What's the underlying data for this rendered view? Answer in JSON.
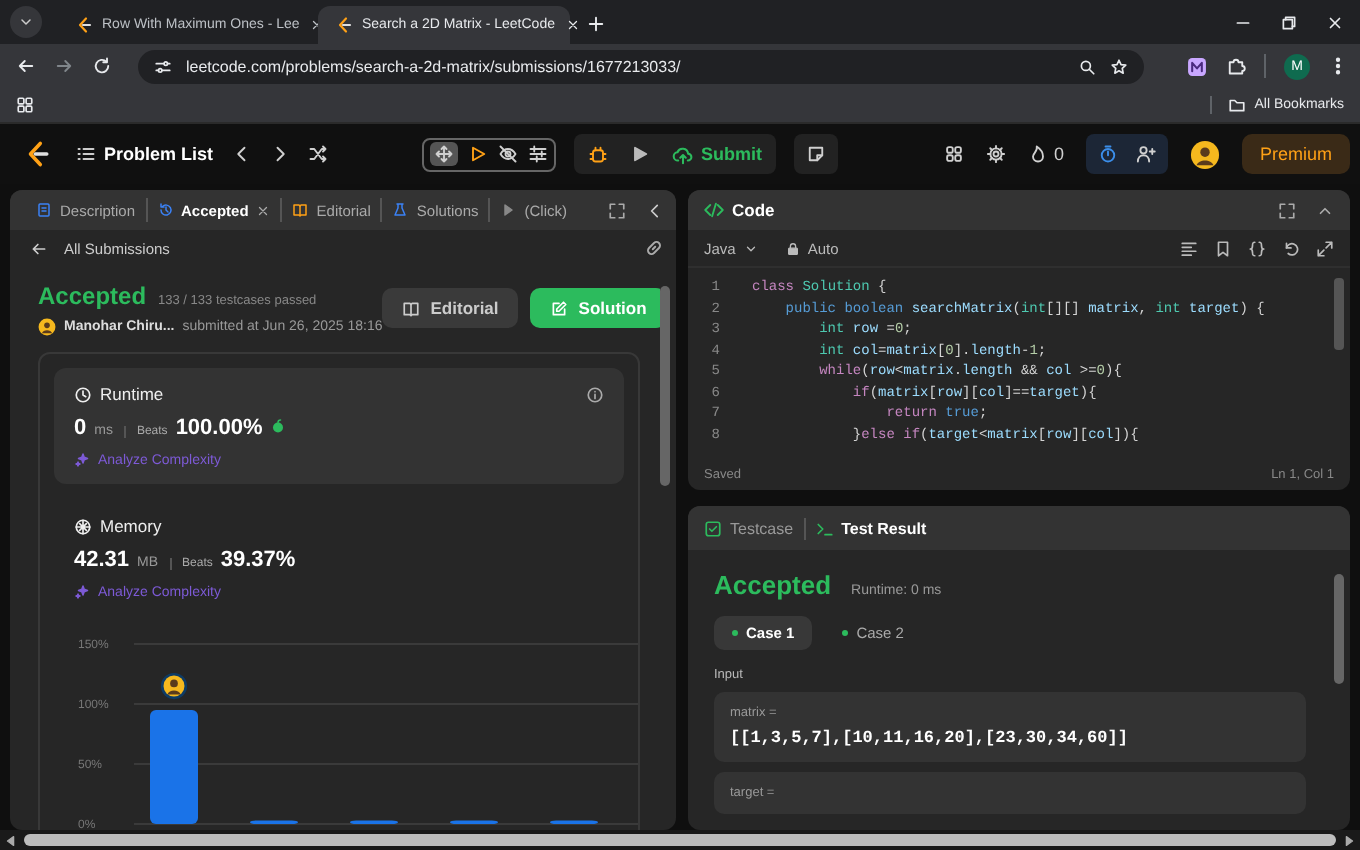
{
  "browser": {
    "tabs": [
      {
        "title": "Row With Maximum Ones - Lee",
        "selected": false
      },
      {
        "title": "Search a 2D Matrix - LeetCode",
        "selected": true
      }
    ],
    "url": "leetcode.com/problems/search-a-2d-matrix/submissions/1677213033/",
    "profile": "M",
    "bookmarks": "All Bookmarks"
  },
  "header": {
    "problem_list": "Problem List",
    "submit": "Submit",
    "streak": "0",
    "premium": "Premium"
  },
  "left_panel": {
    "tabs": [
      {
        "kind": "description",
        "label": "Description",
        "selected": false,
        "closable": false
      },
      {
        "kind": "submission",
        "label": "Accepted",
        "selected": true,
        "closable": true
      },
      {
        "kind": "editorial",
        "label": "Editorial",
        "selected": false,
        "closable": false
      },
      {
        "kind": "solutions",
        "label": "Solutions",
        "selected": false,
        "closable": false
      },
      {
        "kind": "run",
        "label": "(Click)",
        "selected": false,
        "closable": false
      }
    ],
    "back_link": "All Submissions",
    "submission": {
      "status": "Accepted",
      "testcases": "133 / 133 testcases passed",
      "author": "Manohar Chiru...",
      "submitted": "submitted at Jun 26, 2025 18:16"
    },
    "buttons": [
      {
        "kind": "editorial",
        "label": "Editorial"
      },
      {
        "kind": "solution",
        "label": "Solution"
      }
    ],
    "stats": [
      {
        "kind": "runtime",
        "selected": true,
        "title": "Runtime",
        "value": "0",
        "unit": "ms",
        "beats_label": "Beats",
        "beats": "100.00%",
        "link": "Analyze Complexity"
      },
      {
        "kind": "memory",
        "selected": false,
        "title": "Memory",
        "value": "42.31",
        "unit": "MB",
        "beats_label": "Beats",
        "beats": "39.37%",
        "link": "Analyze Complexity"
      }
    ],
    "chart_data": {
      "type": "bar",
      "values": [
        95,
        3,
        3,
        3,
        3
      ],
      "ylim": [
        0,
        150
      ],
      "yticks": [
        {
          "value": 0,
          "label": "0%"
        },
        {
          "value": 50,
          "label": "50%"
        },
        {
          "value": 100,
          "label": "100%"
        },
        {
          "value": 150,
          "label": "150%"
        }
      ]
    }
  },
  "code_panel": {
    "title": "Code",
    "language": "Java",
    "mode": "Auto",
    "lines": [
      {
        "number": "1",
        "tokens": [
          {
            "kind": "keyword",
            "text": "class"
          },
          {
            "kind": "type",
            "text": " Solution"
          },
          {
            "kind": "plain",
            "text": " {"
          }
        ]
      },
      {
        "number": "2",
        "tokens": [
          {
            "kind": "modifier",
            "text": "    public"
          },
          {
            "kind": "modifier",
            "text": " boolean"
          },
          {
            "kind": "ident",
            "text": " searchMatrix"
          },
          {
            "kind": "plain",
            "text": "("
          },
          {
            "kind": "type",
            "text": "int"
          },
          {
            "kind": "plain",
            "text": "[][] "
          },
          {
            "kind": "ident",
            "text": "matrix"
          },
          {
            "kind": "plain",
            "text": ", "
          },
          {
            "kind": "type",
            "text": "int"
          },
          {
            "kind": "ident",
            "text": " target"
          },
          {
            "kind": "plain",
            "text": ") {"
          }
        ]
      },
      {
        "number": "3",
        "tokens": [
          {
            "kind": "type",
            "text": "        int"
          },
          {
            "kind": "ident",
            "text": " row"
          },
          {
            "kind": "plain",
            "text": " ="
          },
          {
            "kind": "number",
            "text": "0"
          },
          {
            "kind": "plain",
            "text": ";"
          }
        ]
      },
      {
        "number": "4",
        "tokens": [
          {
            "kind": "type",
            "text": "        int"
          },
          {
            "kind": "ident",
            "text": " col"
          },
          {
            "kind": "plain",
            "text": "="
          },
          {
            "kind": "ident",
            "text": "matrix"
          },
          {
            "kind": "plain",
            "text": "["
          },
          {
            "kind": "number",
            "text": "0"
          },
          {
            "kind": "plain",
            "text": "]."
          },
          {
            "kind": "ident",
            "text": "length"
          },
          {
            "kind": "plain",
            "text": "-"
          },
          {
            "kind": "number",
            "text": "1"
          },
          {
            "kind": "plain",
            "text": ";"
          }
        ]
      },
      {
        "number": "5",
        "tokens": [
          {
            "kind": "keyword",
            "text": "        while"
          },
          {
            "kind": "plain",
            "text": "("
          },
          {
            "kind": "ident",
            "text": "row"
          },
          {
            "kind": "plain",
            "text": "<"
          },
          {
            "kind": "ident",
            "text": "matrix"
          },
          {
            "kind": "plain",
            "text": "."
          },
          {
            "kind": "ident",
            "text": "length"
          },
          {
            "kind": "plain",
            "text": " && "
          },
          {
            "kind": "ident",
            "text": "col"
          },
          {
            "kind": "plain",
            "text": " >="
          },
          {
            "kind": "number",
            "text": "0"
          },
          {
            "kind": "plain",
            "text": "){"
          }
        ]
      },
      {
        "number": "6",
        "tokens": [
          {
            "kind": "keyword",
            "text": "            if"
          },
          {
            "kind": "plain",
            "text": "("
          },
          {
            "kind": "ident",
            "text": "matrix"
          },
          {
            "kind": "plain",
            "text": "["
          },
          {
            "kind": "ident",
            "text": "row"
          },
          {
            "kind": "plain",
            "text": "]["
          },
          {
            "kind": "ident",
            "text": "col"
          },
          {
            "kind": "plain",
            "text": "]=="
          },
          {
            "kind": "ident",
            "text": "target"
          },
          {
            "kind": "plain",
            "text": "){"
          }
        ]
      },
      {
        "number": "7",
        "tokens": [
          {
            "kind": "keyword",
            "text": "                return"
          },
          {
            "kind": "modifier",
            "text": " true"
          },
          {
            "kind": "plain",
            "text": ";"
          }
        ]
      },
      {
        "number": "8",
        "tokens": [
          {
            "kind": "plain",
            "text": "            }"
          },
          {
            "kind": "keyword",
            "text": "else"
          },
          {
            "kind": "keyword",
            "text": " if"
          },
          {
            "kind": "plain",
            "text": "("
          },
          {
            "kind": "ident",
            "text": "target"
          },
          {
            "kind": "plain",
            "text": "<"
          },
          {
            "kind": "ident",
            "text": "matrix"
          },
          {
            "kind": "plain",
            "text": "["
          },
          {
            "kind": "ident",
            "text": "row"
          },
          {
            "kind": "plain",
            "text": "]["
          },
          {
            "kind": "ident",
            "text": "col"
          },
          {
            "kind": "plain",
            "text": "]){"
          }
        ]
      }
    ],
    "status": "Saved",
    "cursor": "Ln 1, Col 1"
  },
  "test_panel": {
    "tabs": [
      {
        "kind": "testcase",
        "label": "Testcase",
        "selected": false
      },
      {
        "kind": "result",
        "label": "Test Result",
        "selected": true
      }
    ],
    "status": "Accepted",
    "runtime": "Runtime: 0 ms",
    "cases": [
      {
        "label": "Case 1",
        "selected": true
      },
      {
        "label": "Case 2",
        "selected": false
      }
    ],
    "input_label": "Input",
    "params": [
      {
        "name": "matrix =",
        "value": "[[1,3,5,7],[10,11,16,20],[23,30,34,60]]"
      },
      {
        "name": "target ="
      }
    ]
  }
}
